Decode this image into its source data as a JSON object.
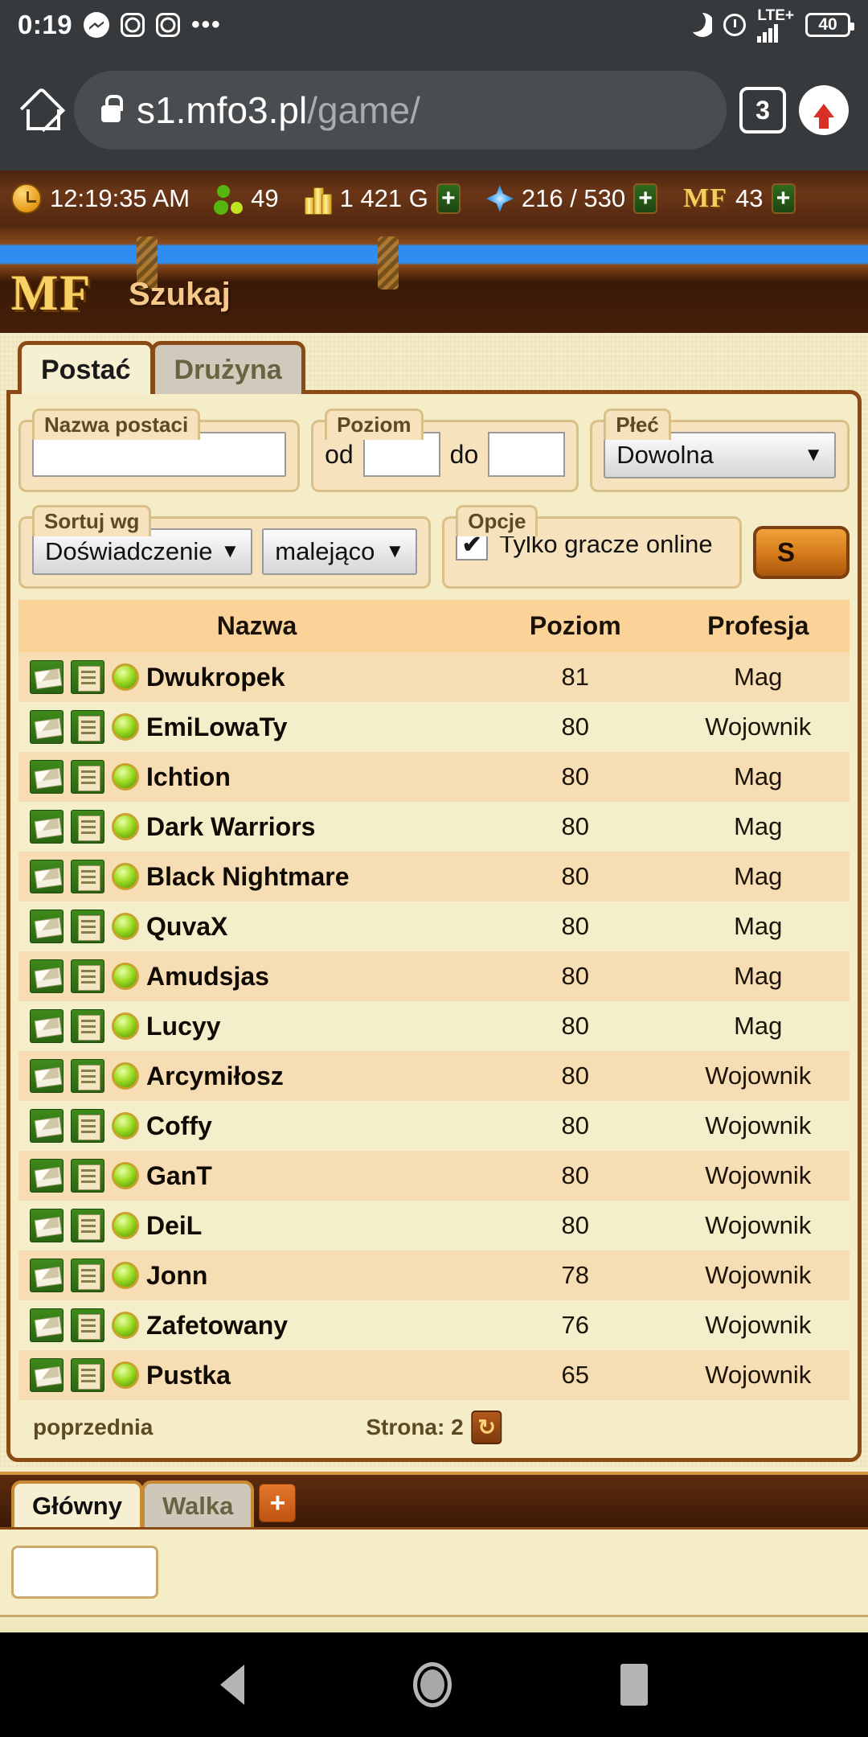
{
  "status_bar": {
    "time": "0:19",
    "icons": [
      "messenger-icon",
      "instagram-icon",
      "instagram-icon",
      "more-dots-icon"
    ],
    "dnd": "moon-icon",
    "alarm": "alarm-icon",
    "network": "LTE+",
    "battery": "40"
  },
  "browser": {
    "home_icon": "home-icon",
    "lock_icon": "lock-icon",
    "url_host": "s1.mfo3.pl",
    "url_path": "/game/",
    "tab_count": "3",
    "upload_icon": "up-arrow-icon"
  },
  "resources": {
    "clock": "12:19:35 AM",
    "players_online": "49",
    "gold": "1 421 G",
    "mana": "216 / 530",
    "mf_label": "MF",
    "mf_value": "43",
    "plus_label": "+"
  },
  "banner": {
    "logo": "MF",
    "page_title": "Szukaj"
  },
  "tabs": [
    {
      "label": "Postać",
      "active": true
    },
    {
      "label": "Drużyna",
      "active": false
    }
  ],
  "form": {
    "name": {
      "legend": "Nazwa postaci",
      "value": "",
      "placeholder": ""
    },
    "level": {
      "legend": "Poziom",
      "from_label": "od",
      "from_value": "",
      "to_label": "do",
      "to_value": ""
    },
    "sex": {
      "legend": "Płeć",
      "value": "Dowolna"
    },
    "sort": {
      "legend": "Sortuj wg",
      "by_value": "Doświadczenie",
      "dir_value": "malejąco"
    },
    "options": {
      "legend": "Opcje",
      "checkbox_label": "Tylko gracze online",
      "checked": true,
      "check_glyph": "✔"
    },
    "search_button": "S"
  },
  "results": {
    "headers": [
      "Nazwa",
      "Poziom",
      "Profesja"
    ],
    "rows": [
      {
        "name": "Dwukropek",
        "level": "81",
        "prof": "Mag"
      },
      {
        "name": "EmiLowaTy",
        "level": "80",
        "prof": "Wojownik"
      },
      {
        "name": "Ichtion",
        "level": "80",
        "prof": "Mag"
      },
      {
        "name": "Dark Warriors",
        "level": "80",
        "prof": "Mag"
      },
      {
        "name": "Black Nightmare",
        "level": "80",
        "prof": "Mag"
      },
      {
        "name": "QuvaX",
        "level": "80",
        "prof": "Mag"
      },
      {
        "name": "Amudsjas",
        "level": "80",
        "prof": "Mag"
      },
      {
        "name": "Lucyy",
        "level": "80",
        "prof": "Mag"
      },
      {
        "name": "Arcymiłosz",
        "level": "80",
        "prof": "Wojownik"
      },
      {
        "name": "Coffy",
        "level": "80",
        "prof": "Wojownik"
      },
      {
        "name": "GanT",
        "level": "80",
        "prof": "Wojownik"
      },
      {
        "name": "DeiL",
        "level": "80",
        "prof": "Wojownik"
      },
      {
        "name": "Jonn",
        "level": "78",
        "prof": "Wojownik"
      },
      {
        "name": "Zafetowany",
        "level": "76",
        "prof": "Wojownik"
      },
      {
        "name": "Pustka",
        "level": "65",
        "prof": "Wojownik"
      }
    ]
  },
  "pagination": {
    "prev_label": "poprzednia",
    "page_label": "Strona: 2",
    "refresh_glyph": "↻"
  },
  "chat": {
    "tabs": [
      {
        "label": "Główny",
        "active": true
      },
      {
        "label": "Walka",
        "active": false
      }
    ],
    "add_label": "+",
    "input_value": ""
  },
  "nav_bar": {
    "back": "back-icon",
    "home": "home-circle-icon",
    "recents": "recents-icon"
  },
  "colors": {
    "wood": "#8a4a16",
    "parchment": "#f5ecc8",
    "header_row": "#fbd399",
    "accent_orange": "#d4791a"
  }
}
